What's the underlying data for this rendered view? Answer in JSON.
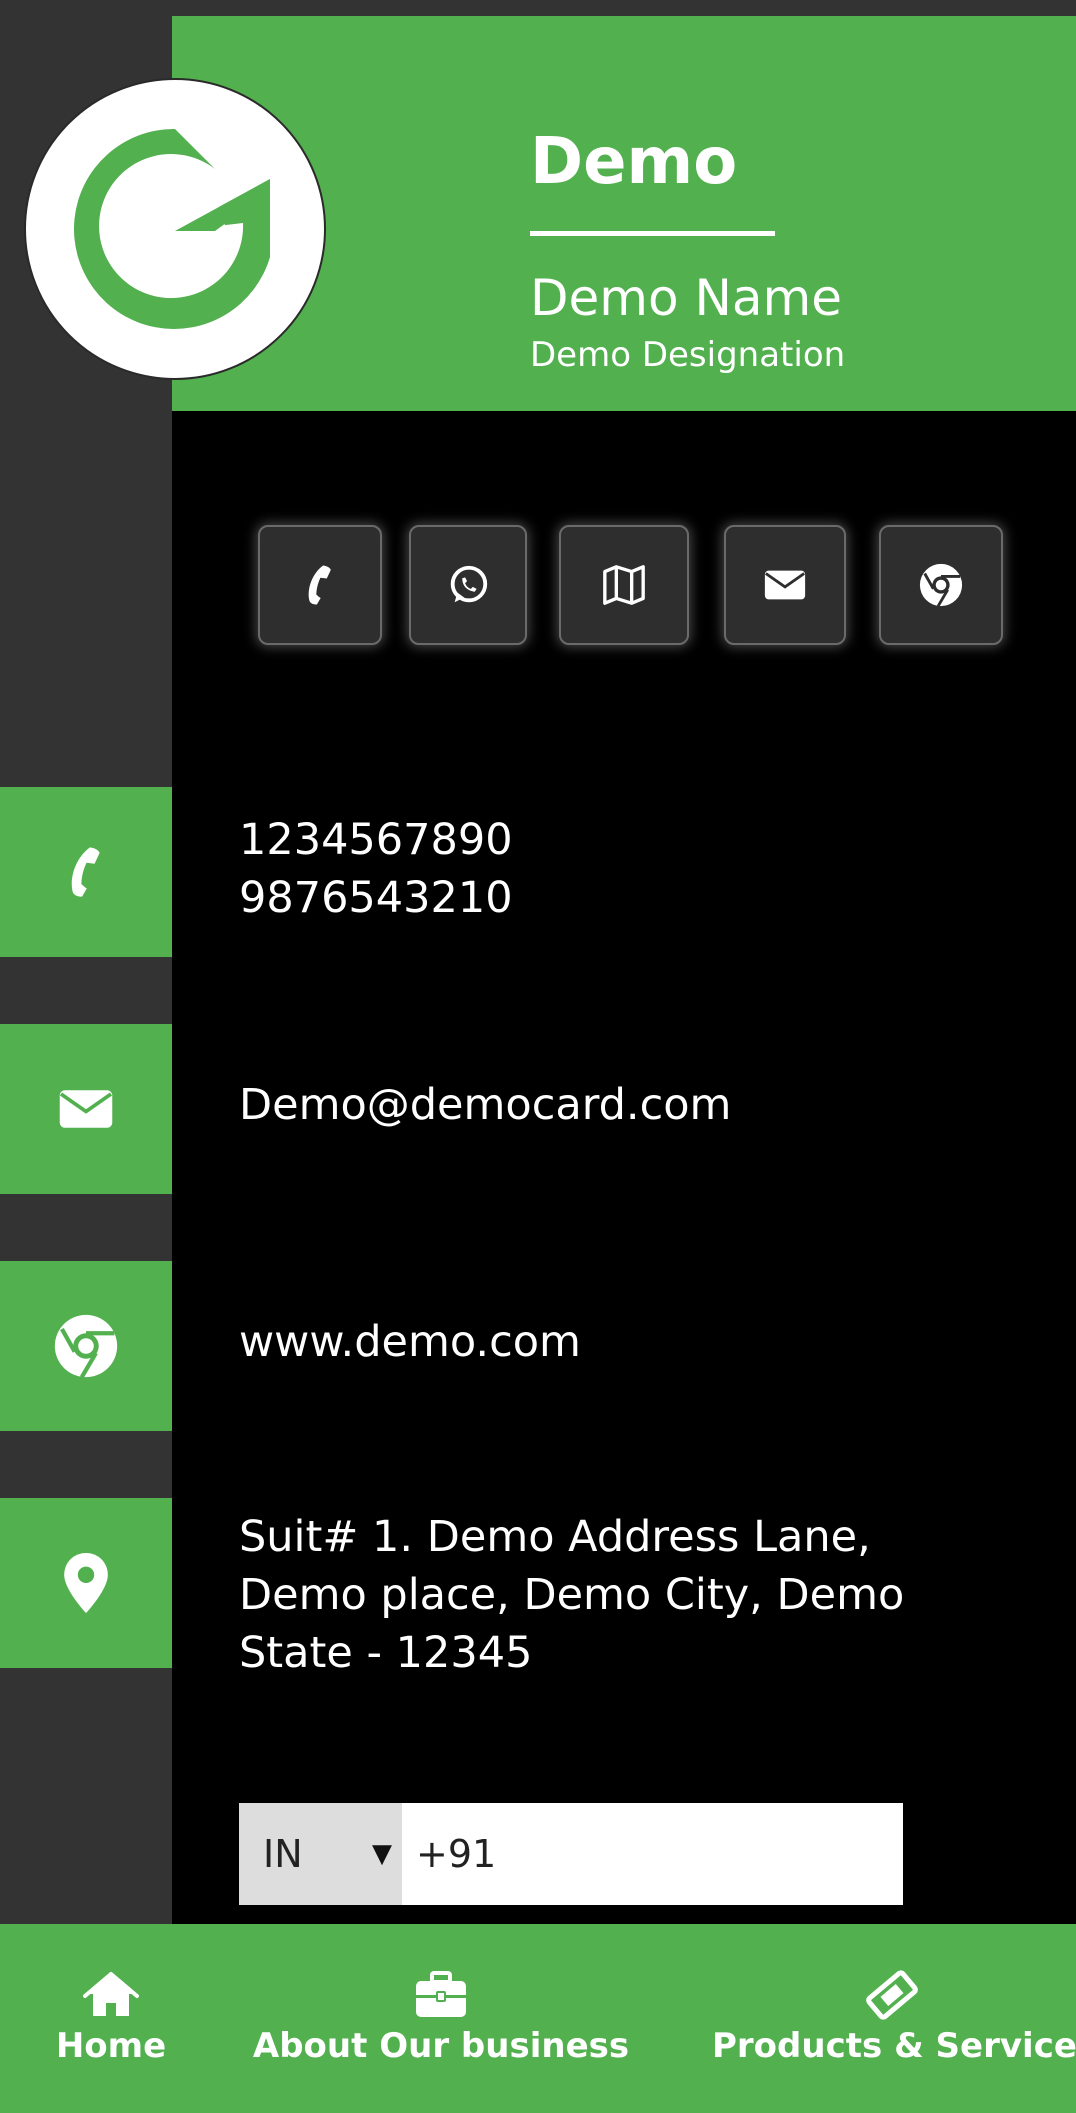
{
  "header": {
    "company": "Demo",
    "name": "Demo Name",
    "designation": "Demo Designation",
    "logo_icon": "g-logo-icon"
  },
  "actions": [
    {
      "name": "call",
      "icon": "phone-icon"
    },
    {
      "name": "whatsapp",
      "icon": "whatsapp-icon"
    },
    {
      "name": "map",
      "icon": "map-icon"
    },
    {
      "name": "email",
      "icon": "envelope-icon"
    },
    {
      "name": "website",
      "icon": "chrome-icon"
    }
  ],
  "contact": {
    "phone1": "1234567890",
    "phone2": "9876543210",
    "email": "Demo@democard.com",
    "website": "www.demo.com",
    "address_line1": "Suit# 1. Demo Address Lane,",
    "address_line2": "Demo place, Demo City, Demo",
    "address_line3": "State - 12345"
  },
  "whatsapp_form": {
    "country": "IN",
    "phone_value": "+91"
  },
  "nav": {
    "home": "Home",
    "about": "About Our business",
    "products": "Products & Services"
  },
  "colors": {
    "accent": "#52b04f",
    "sidebar": "#333333",
    "background": "#000000"
  }
}
